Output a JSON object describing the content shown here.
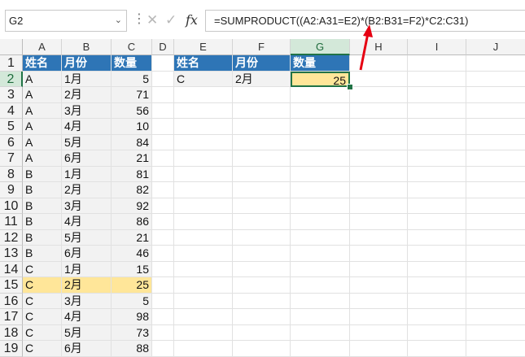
{
  "name_box": {
    "value": "G2",
    "dropdown_icon": "chevron-down-icon"
  },
  "formula_bar": {
    "cancel_icon": "✕",
    "enter_icon": "✓",
    "fx_label": "fx",
    "formula": "=SUMPRODUCT((A2:A31=E2)*(B2:B31=F2)*C2:C31)"
  },
  "columns": [
    "A",
    "B",
    "C",
    "D",
    "E",
    "F",
    "G",
    "H",
    "I",
    "J"
  ],
  "selected_column": "G",
  "rows": [
    "1",
    "2",
    "3",
    "4",
    "5",
    "6",
    "7",
    "8",
    "9",
    "10",
    "11",
    "12",
    "13",
    "14",
    "15",
    "16",
    "17",
    "18",
    "19"
  ],
  "selected_row": "2",
  "table_left": {
    "headers": [
      "姓名",
      "月份",
      "数量"
    ],
    "data": [
      [
        "A",
        "1月",
        "5"
      ],
      [
        "A",
        "2月",
        "71"
      ],
      [
        "A",
        "3月",
        "56"
      ],
      [
        "A",
        "4月",
        "10"
      ],
      [
        "A",
        "5月",
        "84"
      ],
      [
        "A",
        "6月",
        "21"
      ],
      [
        "B",
        "1月",
        "81"
      ],
      [
        "B",
        "2月",
        "82"
      ],
      [
        "B",
        "3月",
        "92"
      ],
      [
        "B",
        "4月",
        "86"
      ],
      [
        "B",
        "5月",
        "21"
      ],
      [
        "B",
        "6月",
        "46"
      ],
      [
        "C",
        "1月",
        "15"
      ],
      [
        "C",
        "2月",
        "25"
      ],
      [
        "C",
        "3月",
        "5"
      ],
      [
        "C",
        "4月",
        "98"
      ],
      [
        "C",
        "5月",
        "73"
      ],
      [
        "C",
        "6月",
        "88"
      ]
    ],
    "highlight_row_index": 13
  },
  "table_right": {
    "headers": [
      "姓名",
      "月份",
      "数量"
    ],
    "row": [
      "C",
      "2月",
      "25"
    ]
  },
  "colors": {
    "header_blue": "#2e75b6",
    "highlight_yellow": "#ffe699",
    "selection_green": "#217346",
    "arrow_red": "#e60012"
  }
}
